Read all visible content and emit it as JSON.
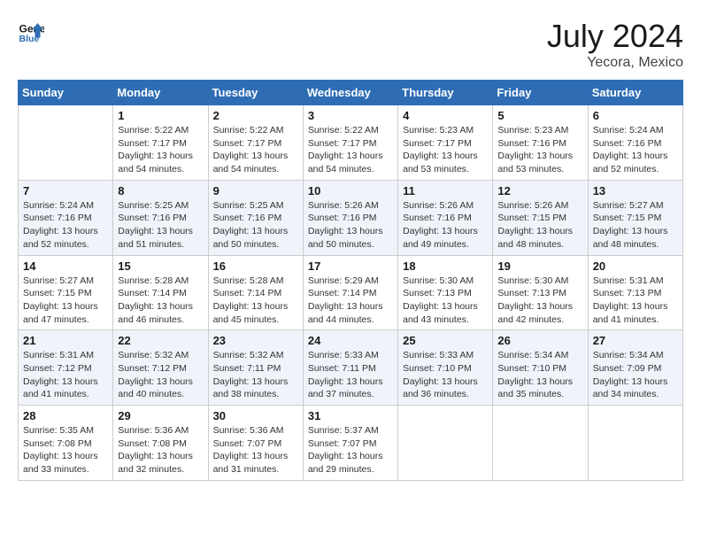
{
  "header": {
    "logo_line1": "General",
    "logo_line2": "Blue",
    "month": "July 2024",
    "location": "Yecora, Mexico"
  },
  "weekdays": [
    "Sunday",
    "Monday",
    "Tuesday",
    "Wednesday",
    "Thursday",
    "Friday",
    "Saturday"
  ],
  "weeks": [
    [
      {
        "day": "",
        "sunrise": "",
        "sunset": "",
        "daylight": ""
      },
      {
        "day": "1",
        "sunrise": "Sunrise: 5:22 AM",
        "sunset": "Sunset: 7:17 PM",
        "daylight": "Daylight: 13 hours and 54 minutes."
      },
      {
        "day": "2",
        "sunrise": "Sunrise: 5:22 AM",
        "sunset": "Sunset: 7:17 PM",
        "daylight": "Daylight: 13 hours and 54 minutes."
      },
      {
        "day": "3",
        "sunrise": "Sunrise: 5:22 AM",
        "sunset": "Sunset: 7:17 PM",
        "daylight": "Daylight: 13 hours and 54 minutes."
      },
      {
        "day": "4",
        "sunrise": "Sunrise: 5:23 AM",
        "sunset": "Sunset: 7:17 PM",
        "daylight": "Daylight: 13 hours and 53 minutes."
      },
      {
        "day": "5",
        "sunrise": "Sunrise: 5:23 AM",
        "sunset": "Sunset: 7:16 PM",
        "daylight": "Daylight: 13 hours and 53 minutes."
      },
      {
        "day": "6",
        "sunrise": "Sunrise: 5:24 AM",
        "sunset": "Sunset: 7:16 PM",
        "daylight": "Daylight: 13 hours and 52 minutes."
      }
    ],
    [
      {
        "day": "7",
        "sunrise": "Sunrise: 5:24 AM",
        "sunset": "Sunset: 7:16 PM",
        "daylight": "Daylight: 13 hours and 52 minutes."
      },
      {
        "day": "8",
        "sunrise": "Sunrise: 5:25 AM",
        "sunset": "Sunset: 7:16 PM",
        "daylight": "Daylight: 13 hours and 51 minutes."
      },
      {
        "day": "9",
        "sunrise": "Sunrise: 5:25 AM",
        "sunset": "Sunset: 7:16 PM",
        "daylight": "Daylight: 13 hours and 50 minutes."
      },
      {
        "day": "10",
        "sunrise": "Sunrise: 5:26 AM",
        "sunset": "Sunset: 7:16 PM",
        "daylight": "Daylight: 13 hours and 50 minutes."
      },
      {
        "day": "11",
        "sunrise": "Sunrise: 5:26 AM",
        "sunset": "Sunset: 7:16 PM",
        "daylight": "Daylight: 13 hours and 49 minutes."
      },
      {
        "day": "12",
        "sunrise": "Sunrise: 5:26 AM",
        "sunset": "Sunset: 7:15 PM",
        "daylight": "Daylight: 13 hours and 48 minutes."
      },
      {
        "day": "13",
        "sunrise": "Sunrise: 5:27 AM",
        "sunset": "Sunset: 7:15 PM",
        "daylight": "Daylight: 13 hours and 48 minutes."
      }
    ],
    [
      {
        "day": "14",
        "sunrise": "Sunrise: 5:27 AM",
        "sunset": "Sunset: 7:15 PM",
        "daylight": "Daylight: 13 hours and 47 minutes."
      },
      {
        "day": "15",
        "sunrise": "Sunrise: 5:28 AM",
        "sunset": "Sunset: 7:14 PM",
        "daylight": "Daylight: 13 hours and 46 minutes."
      },
      {
        "day": "16",
        "sunrise": "Sunrise: 5:28 AM",
        "sunset": "Sunset: 7:14 PM",
        "daylight": "Daylight: 13 hours and 45 minutes."
      },
      {
        "day": "17",
        "sunrise": "Sunrise: 5:29 AM",
        "sunset": "Sunset: 7:14 PM",
        "daylight": "Daylight: 13 hours and 44 minutes."
      },
      {
        "day": "18",
        "sunrise": "Sunrise: 5:30 AM",
        "sunset": "Sunset: 7:13 PM",
        "daylight": "Daylight: 13 hours and 43 minutes."
      },
      {
        "day": "19",
        "sunrise": "Sunrise: 5:30 AM",
        "sunset": "Sunset: 7:13 PM",
        "daylight": "Daylight: 13 hours and 42 minutes."
      },
      {
        "day": "20",
        "sunrise": "Sunrise: 5:31 AM",
        "sunset": "Sunset: 7:13 PM",
        "daylight": "Daylight: 13 hours and 41 minutes."
      }
    ],
    [
      {
        "day": "21",
        "sunrise": "Sunrise: 5:31 AM",
        "sunset": "Sunset: 7:12 PM",
        "daylight": "Daylight: 13 hours and 41 minutes."
      },
      {
        "day": "22",
        "sunrise": "Sunrise: 5:32 AM",
        "sunset": "Sunset: 7:12 PM",
        "daylight": "Daylight: 13 hours and 40 minutes."
      },
      {
        "day": "23",
        "sunrise": "Sunrise: 5:32 AM",
        "sunset": "Sunset: 7:11 PM",
        "daylight": "Daylight: 13 hours and 38 minutes."
      },
      {
        "day": "24",
        "sunrise": "Sunrise: 5:33 AM",
        "sunset": "Sunset: 7:11 PM",
        "daylight": "Daylight: 13 hours and 37 minutes."
      },
      {
        "day": "25",
        "sunrise": "Sunrise: 5:33 AM",
        "sunset": "Sunset: 7:10 PM",
        "daylight": "Daylight: 13 hours and 36 minutes."
      },
      {
        "day": "26",
        "sunrise": "Sunrise: 5:34 AM",
        "sunset": "Sunset: 7:10 PM",
        "daylight": "Daylight: 13 hours and 35 minutes."
      },
      {
        "day": "27",
        "sunrise": "Sunrise: 5:34 AM",
        "sunset": "Sunset: 7:09 PM",
        "daylight": "Daylight: 13 hours and 34 minutes."
      }
    ],
    [
      {
        "day": "28",
        "sunrise": "Sunrise: 5:35 AM",
        "sunset": "Sunset: 7:08 PM",
        "daylight": "Daylight: 13 hours and 33 minutes."
      },
      {
        "day": "29",
        "sunrise": "Sunrise: 5:36 AM",
        "sunset": "Sunset: 7:08 PM",
        "daylight": "Daylight: 13 hours and 32 minutes."
      },
      {
        "day": "30",
        "sunrise": "Sunrise: 5:36 AM",
        "sunset": "Sunset: 7:07 PM",
        "daylight": "Daylight: 13 hours and 31 minutes."
      },
      {
        "day": "31",
        "sunrise": "Sunrise: 5:37 AM",
        "sunset": "Sunset: 7:07 PM",
        "daylight": "Daylight: 13 hours and 29 minutes."
      },
      {
        "day": "",
        "sunrise": "",
        "sunset": "",
        "daylight": ""
      },
      {
        "day": "",
        "sunrise": "",
        "sunset": "",
        "daylight": ""
      },
      {
        "day": "",
        "sunrise": "",
        "sunset": "",
        "daylight": ""
      }
    ]
  ]
}
